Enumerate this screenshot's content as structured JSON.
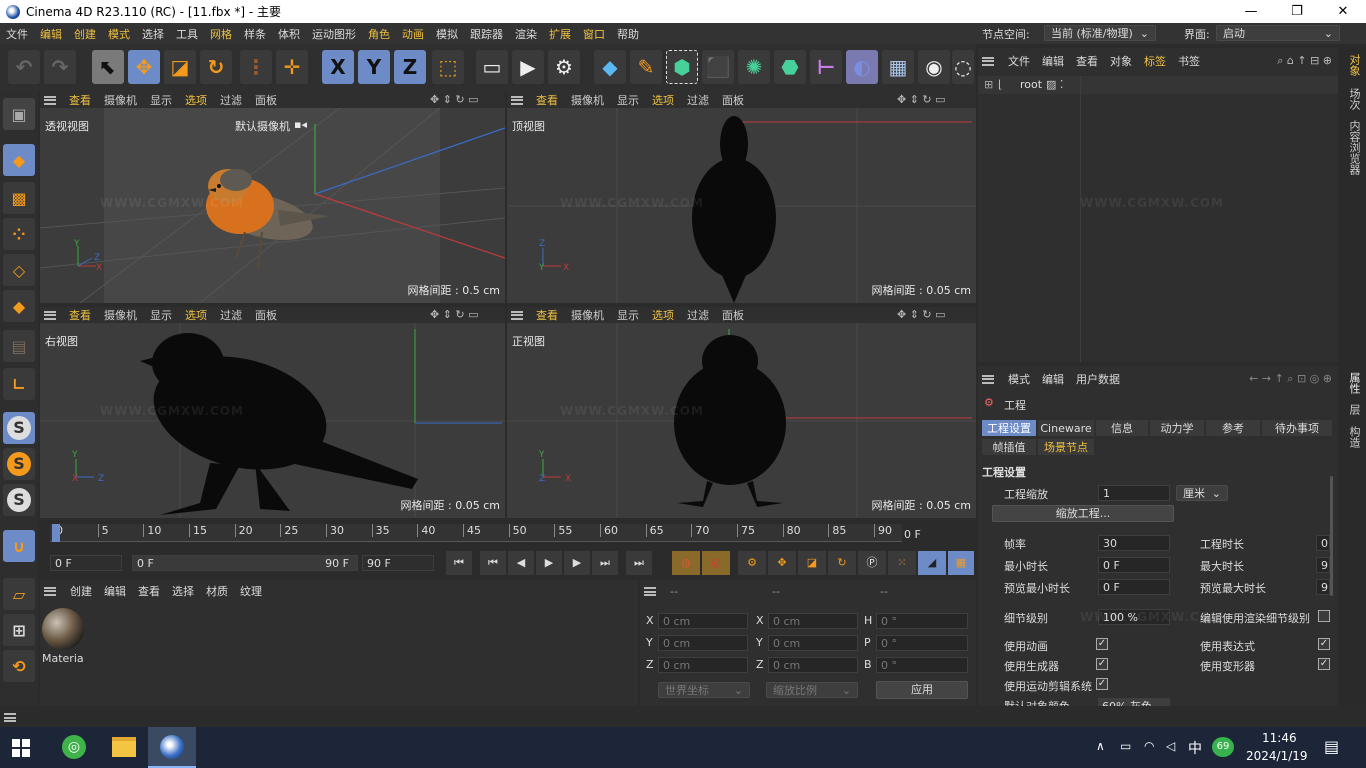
{
  "window": {
    "title": "Cinema 4D R23.110 (RC) - [11.fbx *] - 主要",
    "minimize": "—",
    "maximize": "❐",
    "close": "✕"
  },
  "menu": [
    "文件",
    "编辑",
    "创建",
    "模式",
    "选择",
    "工具",
    "网格",
    "样条",
    "体积",
    "运动图形",
    "角色",
    "动画",
    "模拟",
    "跟踪器",
    "渲染",
    "扩展",
    "窗口",
    "帮助"
  ],
  "node_space": {
    "label": "节点空间:",
    "value": "当前 (标准/物理)"
  },
  "layout": {
    "label": "界面:",
    "value": "启动"
  },
  "toolbar": {
    "x": "X",
    "y": "Y",
    "z": "Z",
    "c_icon": "C"
  },
  "viewport_menu": [
    "查看",
    "摄像机",
    "显示",
    "选项",
    "过滤",
    "面板"
  ],
  "viewports": {
    "perspective": {
      "name": "透视视图",
      "camera": "默认摄像机",
      "grid": "网格间距 : 0.5 cm"
    },
    "top": {
      "name": "顶视图",
      "grid": "网格间距 : 0.05 cm"
    },
    "right": {
      "name": "右视图",
      "grid": "网格间距 : 0.05 cm"
    },
    "front": {
      "name": "正视图",
      "grid": "网格间距 : 0.05 cm"
    }
  },
  "axis": {
    "x": "X",
    "y": "Y",
    "z": "Z"
  },
  "timeline": {
    "ticks": [
      "0",
      "5",
      "10",
      "15",
      "20",
      "25",
      "30",
      "35",
      "40",
      "45",
      "50",
      "55",
      "60",
      "65",
      "70",
      "75",
      "80",
      "85",
      "90"
    ],
    "end": "0 F",
    "current": "0 F",
    "range_start": "0 F",
    "range_end": "90 F",
    "max": "90 F"
  },
  "object_manager": {
    "menu": [
      "文件",
      "编辑",
      "查看",
      "对象",
      "标签",
      "书签"
    ],
    "root": "root"
  },
  "attr_manager": {
    "menu": [
      "模式",
      "编辑",
      "用户数据"
    ],
    "title": "工程",
    "tabs": [
      "工程设置",
      "Cineware",
      "信息",
      "动力学",
      "参考",
      "待办事项"
    ],
    "tabs2": [
      "帧插值",
      "场景节点"
    ],
    "section": "工程设置",
    "scale_label": "工程缩放",
    "scale_value": "1",
    "scale_unit": "厘米",
    "scale_button": "缩放工程...",
    "fps_label": "帧率",
    "fps_value": "30",
    "duration_label": "工程时长",
    "duration_value": "0",
    "min_label": "最小时长",
    "min_value": "0 F",
    "max_label": "最大时长",
    "max_value": "9",
    "pmin_label": "预览最小时长",
    "pmin_value": "0 F",
    "pmax_label": "预览最大时长",
    "pmax_value": "9",
    "lod_label": "细节级别",
    "lod_value": "100 %",
    "render_lod_label": "编辑使用渲染细节级别",
    "use_anim": "使用动画",
    "use_expr": "使用表达式",
    "use_gen": "使用生成器",
    "use_deform": "使用变形器",
    "use_motion": "使用运动剪辑系统",
    "obj_color_label": "默认对象颜色",
    "obj_color_value": "60% 灰色"
  },
  "side_tabs": [
    "对象",
    "场次",
    "内容浏览器",
    "属性",
    "层",
    "构造"
  ],
  "material_manager": {
    "menu": [
      "创建",
      "编辑",
      "查看",
      "选择",
      "材质",
      "纹理"
    ],
    "material": "Materia"
  },
  "coord_manager": {
    "headers": [
      "--",
      "--",
      "--"
    ],
    "rows": [
      {
        "a": "X",
        "av": "0 cm",
        "b": "X",
        "bv": "0 cm",
        "c": "H",
        "cv": "0 °"
      },
      {
        "a": "Y",
        "av": "0 cm",
        "b": "Y",
        "bv": "0 cm",
        "c": "P",
        "cv": "0 °"
      },
      {
        "a": "Z",
        "av": "0 cm",
        "b": "Z",
        "bv": "0 cm",
        "c": "B",
        "cv": "0 °"
      }
    ],
    "world": "世界坐标",
    "scale": "缩放比例",
    "apply": "应用"
  },
  "taskbar": {
    "time": "11:46",
    "date": "2024/1/19",
    "ime": "中",
    "badge": "69"
  },
  "watermark": "WWW.CGMXW.COM"
}
